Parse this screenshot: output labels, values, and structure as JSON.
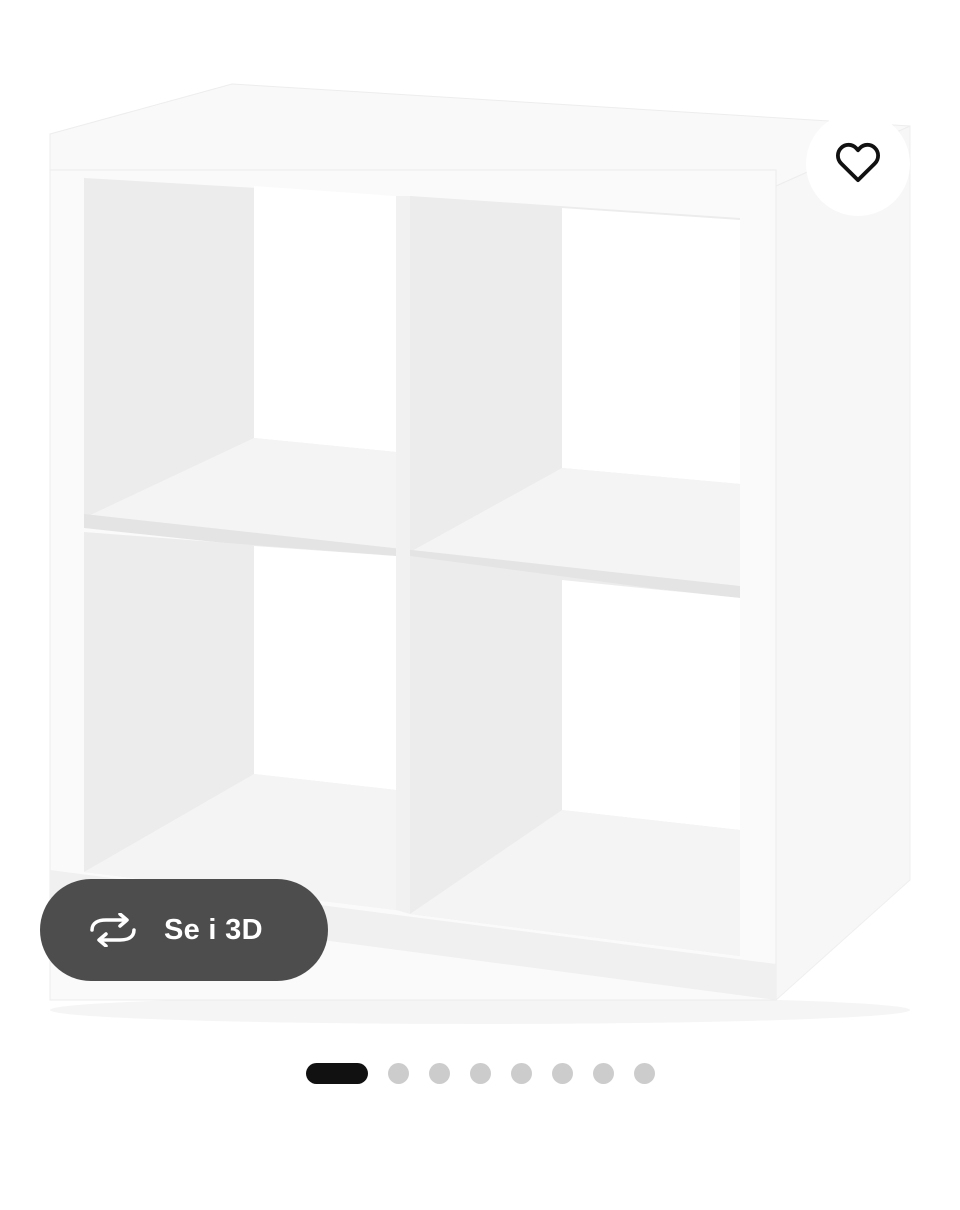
{
  "product": {
    "image_alt": "KALLAX"
  },
  "favourite": {
    "icon": "heart-outline-icon"
  },
  "view3d": {
    "label": "Se i 3D",
    "icon": "rotate-3d-icon"
  },
  "carousel": {
    "total": 8,
    "current": 1
  },
  "colors": {
    "pill_background": "#4d4d4d",
    "dot_active": "#111111",
    "dot_inactive": "#cccccc"
  }
}
